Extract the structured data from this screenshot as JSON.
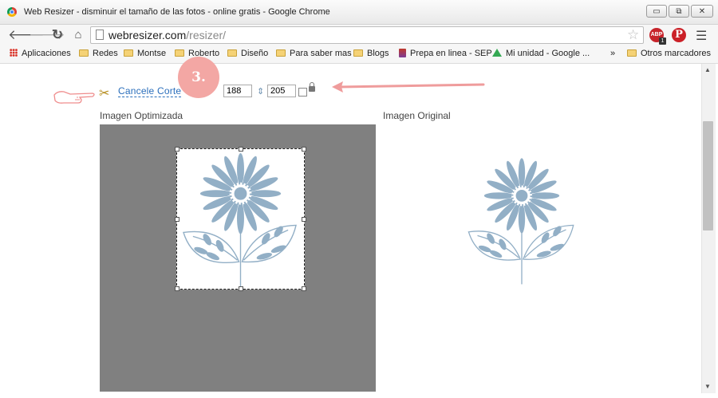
{
  "window": {
    "title": "Web Resizer - disminuir el tamaño de las fotos - online gratis - Google Chrome",
    "controls": {
      "minimize": "▭",
      "maximize": "⧉",
      "close": "✕"
    }
  },
  "toolbar": {
    "url_host": "webresizer.com",
    "url_path": "/resizer/",
    "icons": [
      "back-arrow-icon",
      "forward-arrow-icon",
      "reload-icon",
      "home-icon",
      "star-icon",
      "adblock-icon",
      "pinterest-icon",
      "menu-icon"
    ],
    "abp_text": "ABP",
    "abp_badge": "1",
    "pinterest_letter": "P"
  },
  "bookmarks": {
    "items": [
      {
        "label": "Aplicaciones",
        "icon": "apps-icon"
      },
      {
        "label": "Redes",
        "icon": "folder-icon"
      },
      {
        "label": "Montse",
        "icon": "folder-icon"
      },
      {
        "label": "Roberto",
        "icon": "folder-icon"
      },
      {
        "label": "Diseño",
        "icon": "folder-icon"
      },
      {
        "label": "Para saber mas",
        "icon": "folder-icon"
      },
      {
        "label": "Blogs",
        "icon": "folder-icon"
      },
      {
        "label": "Prepa en linea - SEP",
        "icon": "prepa-icon"
      },
      {
        "label": "Mi unidad - Google ...",
        "icon": "drive-icon"
      }
    ],
    "overflow": "»",
    "other": "Otros marcadores"
  },
  "editor": {
    "step_badge": "3.",
    "cancel_crop": "Cancele Corte",
    "width": "188",
    "height": "205",
    "lock_aspect": false,
    "optimized_label": "Imagen Optimizada",
    "original_label": "Imagen Original"
  },
  "colors": {
    "flower": "#92afc6",
    "panel": "#808080",
    "badge": "#f3a7a4",
    "arrow": "#ef9c9c",
    "link": "#2a6ebb"
  }
}
